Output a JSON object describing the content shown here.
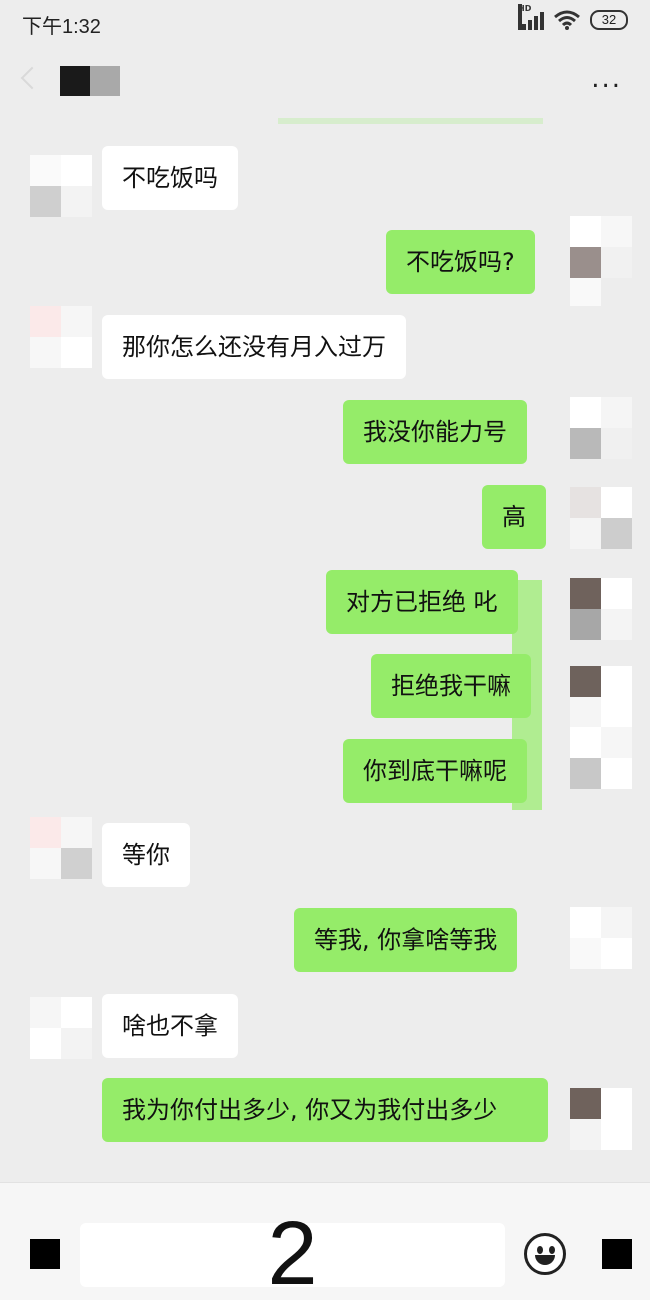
{
  "status_bar": {
    "time": "下午1:32",
    "hd": "HD",
    "battery": "32"
  },
  "header": {
    "more_label": "..."
  },
  "messages": [
    {
      "side": "left",
      "text": "不吃饭吗"
    },
    {
      "side": "right",
      "text": "不吃饭吗?"
    },
    {
      "side": "left",
      "text": "那你怎么还没有月入过万"
    },
    {
      "side": "right",
      "text": "我没你能力号"
    },
    {
      "side": "right",
      "text": "高"
    },
    {
      "side": "right",
      "text": "对方已拒绝 叱"
    },
    {
      "side": "right",
      "text": "拒绝我干嘛"
    },
    {
      "side": "right",
      "text": "你到底干嘛呢"
    },
    {
      "side": "left",
      "text": "等你"
    },
    {
      "side": "right",
      "text": "等我, 你拿啥等我"
    },
    {
      "side": "left",
      "text": "啥也不拿"
    },
    {
      "side": "right",
      "text": "我为你付出多少, 你又为我付出多少"
    }
  ],
  "input_bar": {
    "text": "2"
  },
  "colors": {
    "background": "#ededed",
    "bubble_sent": "#95ec69",
    "bubble_received": "#ffffff"
  }
}
